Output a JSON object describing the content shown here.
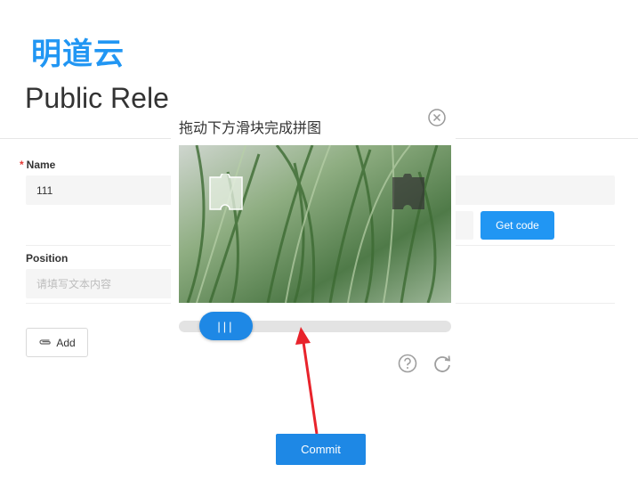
{
  "logo": {
    "text": "明道云"
  },
  "page": {
    "title": "Public Rele"
  },
  "form": {
    "name_label": "Name",
    "name_value": "111",
    "get_code_label": "Get code",
    "position_label": "Position",
    "position_placeholder": "请填写文本内容",
    "add_label": "Add"
  },
  "captcha": {
    "title": "拖动下方滑块完成拼图",
    "slider_handle_glyph": "|||",
    "slider_progress": 0.12
  },
  "footer": {
    "commit_label": "Commit"
  },
  "colors": {
    "primary": "#1e88e5",
    "required": "#e53935",
    "annotation_arrow": "#e8232b"
  }
}
